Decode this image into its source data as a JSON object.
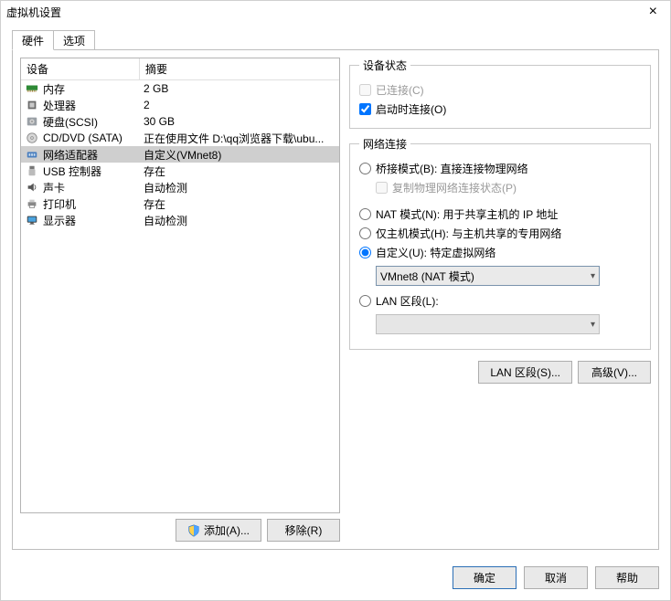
{
  "window": {
    "title": "虚拟机设置"
  },
  "tabs": {
    "hardware": "硬件",
    "options": "选项"
  },
  "table": {
    "col_device": "设备",
    "col_summary": "摘要",
    "rows": [
      {
        "name": "内存",
        "summary": "2 GB",
        "icon": "memory",
        "selected": false
      },
      {
        "name": "处理器",
        "summary": "2",
        "icon": "cpu",
        "selected": false
      },
      {
        "name": "硬盘(SCSI)",
        "summary": "30 GB",
        "icon": "disk",
        "selected": false
      },
      {
        "name": "CD/DVD (SATA)",
        "summary": "正在使用文件 D:\\qq浏览器下载\\ubu...",
        "icon": "cd",
        "selected": false
      },
      {
        "name": "网络适配器",
        "summary": "自定义(VMnet8)",
        "icon": "nic",
        "selected": true
      },
      {
        "name": "USB 控制器",
        "summary": "存在",
        "icon": "usb",
        "selected": false
      },
      {
        "name": "声卡",
        "summary": "自动检测",
        "icon": "sound",
        "selected": false
      },
      {
        "name": "打印机",
        "summary": "存在",
        "icon": "printer",
        "selected": false
      },
      {
        "name": "显示器",
        "summary": "自动检测",
        "icon": "display",
        "selected": false
      }
    ]
  },
  "left_buttons": {
    "add": "添加(A)...",
    "remove": "移除(R)"
  },
  "status_group": {
    "legend": "设备状态",
    "connected": "已连接(C)",
    "connect_on_poweron": "启动时连接(O)",
    "connected_checked": false,
    "poweron_checked": true,
    "connected_enabled": false
  },
  "net_group": {
    "legend": "网络连接",
    "bridged": "桥接模式(B): 直接连接物理网络",
    "bridged_replicate": "复制物理网络连接状态(P)",
    "nat": "NAT 模式(N): 用于共享主机的 IP 地址",
    "hostonly": "仅主机模式(H): 与主机共享的专用网络",
    "custom": "自定义(U): 特定虚拟网络",
    "custom_value": "VMnet8 (NAT 模式)",
    "lan": "LAN 区段(L):",
    "lan_value": "",
    "selected": "custom"
  },
  "right_buttons": {
    "lanseg": "LAN 区段(S)...",
    "advanced": "高级(V)..."
  },
  "footer": {
    "ok": "确定",
    "cancel": "取消",
    "help": "帮助"
  }
}
